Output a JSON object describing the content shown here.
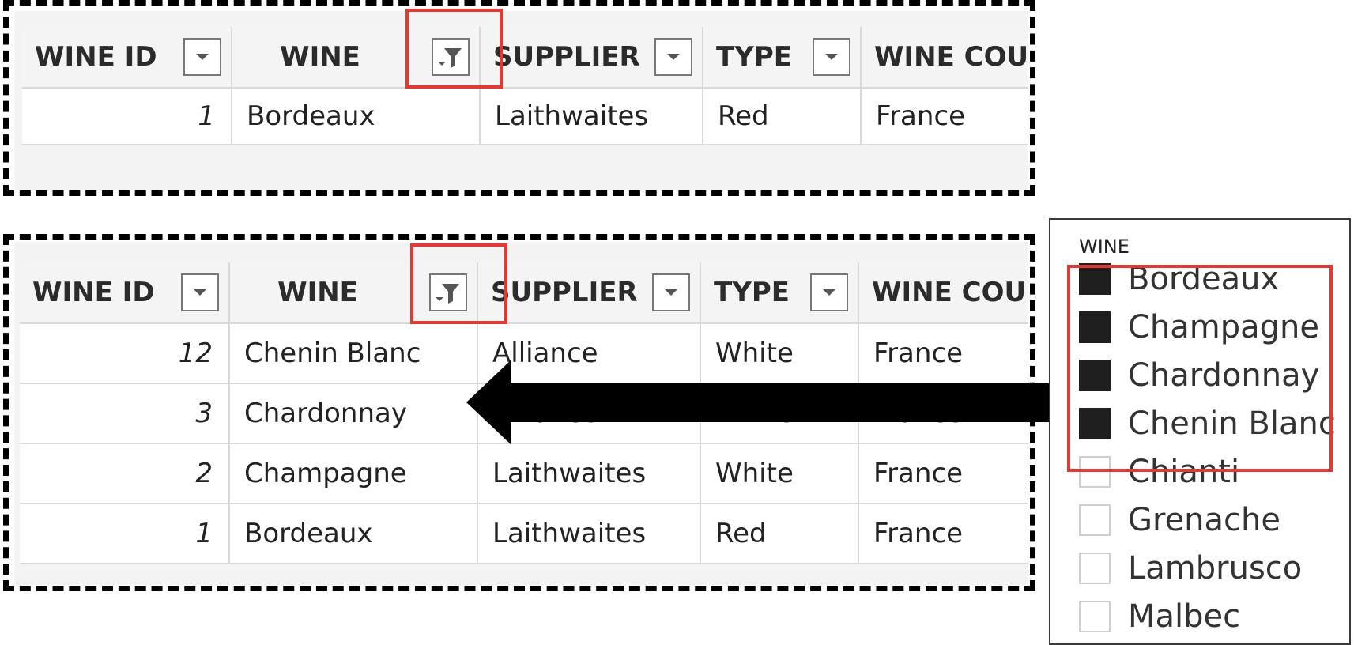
{
  "columns": [
    "WINE ID",
    "WINE",
    "SUPPLIER",
    "TYPE",
    "WINE COU"
  ],
  "table_top": {
    "rows": [
      {
        "id": "1",
        "wine": "Bordeaux",
        "supplier": "Laithwaites",
        "type": "Red",
        "country": "France"
      }
    ]
  },
  "table_bottom": {
    "rows": [
      {
        "id": "12",
        "wine": "Chenin Blanc",
        "supplier": "Alliance",
        "type": "White",
        "country": "France"
      },
      {
        "id": "3",
        "wine": "Chardonnay",
        "supplier": "Alliance",
        "type": "White",
        "country": "France"
      },
      {
        "id": "2",
        "wine": "Champagne",
        "supplier": "Laithwaites",
        "type": "White",
        "country": "France"
      },
      {
        "id": "1",
        "wine": "Bordeaux",
        "supplier": "Laithwaites",
        "type": "Red",
        "country": "France"
      }
    ]
  },
  "slicer": {
    "title": "WINE",
    "items": [
      {
        "label": "Bordeaux",
        "checked": true
      },
      {
        "label": "Champagne",
        "checked": true
      },
      {
        "label": "Chardonnay",
        "checked": true
      },
      {
        "label": "Chenin Blanc",
        "checked": true
      },
      {
        "label": "Chianti",
        "checked": false
      },
      {
        "label": "Grenache",
        "checked": false
      },
      {
        "label": "Lambrusco",
        "checked": false
      },
      {
        "label": "Malbec",
        "checked": false
      }
    ]
  },
  "icons": {
    "dropdown": "dropdown-arrow-icon",
    "filter": "filter-active-icon",
    "arrow": "left-arrow-icon"
  },
  "colors": {
    "highlight": "#e03a35",
    "dash": "#000000",
    "checked": "#1f1f1f"
  }
}
